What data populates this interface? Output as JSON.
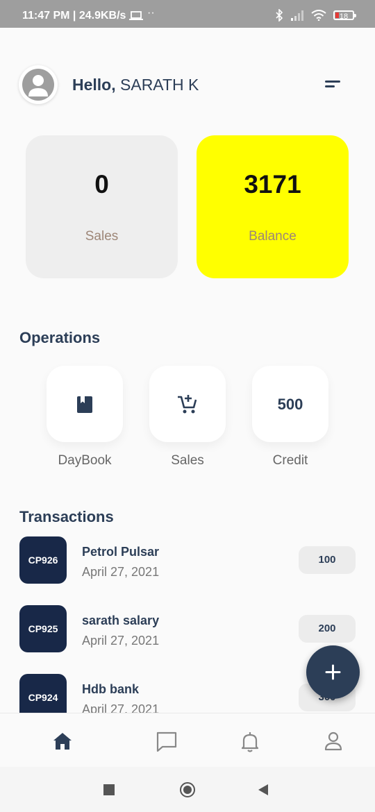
{
  "status_bar": {
    "time": "11:47 PM | 24.9KB/s",
    "battery": "18"
  },
  "header": {
    "greeting_prefix": "Hello,",
    "user_name": "SARATH K"
  },
  "summary_cards": [
    {
      "value": "0",
      "label": "Sales",
      "background": "#eeeeee"
    },
    {
      "value": "3171",
      "label": "Balance",
      "background": "#ffff00"
    }
  ],
  "operations": {
    "title": "Operations",
    "items": [
      {
        "label": "DayBook",
        "icon": "book-icon"
      },
      {
        "label": "Sales",
        "icon": "add-cart-icon"
      },
      {
        "label": "Credit",
        "value": "500"
      }
    ]
  },
  "transactions": {
    "title": "Transactions",
    "items": [
      {
        "code": "CP926",
        "title": "Petrol Pulsar",
        "date": "April 27, 2021",
        "amount": "100"
      },
      {
        "code": "CP925",
        "title": "sarath salary",
        "date": "April 27, 2021",
        "amount": "200"
      },
      {
        "code": "CP924",
        "title": "Hdb bank",
        "date": "April 27, 2021",
        "amount": "300"
      }
    ]
  },
  "fab": {
    "icon": "plus-icon"
  },
  "bottom_nav": [
    {
      "icon": "home-icon",
      "active": true
    },
    {
      "icon": "chat-icon",
      "active": false
    },
    {
      "icon": "bell-icon",
      "active": false
    },
    {
      "icon": "profile-icon",
      "active": false
    }
  ],
  "colors": {
    "primary": "#2c3e57",
    "code_bg": "#182848",
    "balance_card": "#ffff00",
    "sales_card": "#eeeeee"
  }
}
